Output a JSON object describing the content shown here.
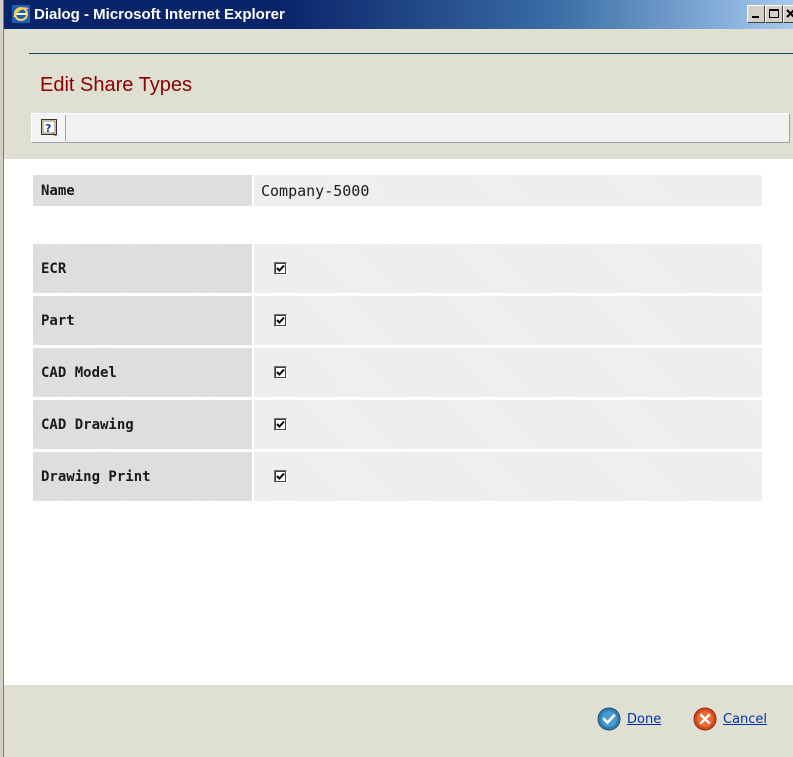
{
  "window": {
    "title": "Dialog - Microsoft Internet Explorer",
    "icon": "ie-icon",
    "controls": [
      "minimize-icon",
      "maximize-icon",
      "close-icon"
    ]
  },
  "page": {
    "title": "Edit Share Types"
  },
  "toolbar": {
    "help_icon": "help-icon"
  },
  "form": {
    "name_label": "Name",
    "name_value": "Company-5000",
    "share_types": [
      {
        "label": "ECR",
        "checked": true
      },
      {
        "label": "Part",
        "checked": true
      },
      {
        "label": "CAD Model",
        "checked": true
      },
      {
        "label": "CAD Drawing",
        "checked": true
      },
      {
        "label": "Drawing Print",
        "checked": true
      }
    ]
  },
  "footer": {
    "done_label": "Done",
    "cancel_label": "Cancel"
  },
  "colors": {
    "title_red": "#8b0000",
    "titlebar_blue": "#0a246a",
    "panel_beige": "#dfdfd2",
    "link_blue": "#0033aa",
    "done_icon": "#2f7fb0",
    "cancel_icon": "#d84a1a"
  }
}
